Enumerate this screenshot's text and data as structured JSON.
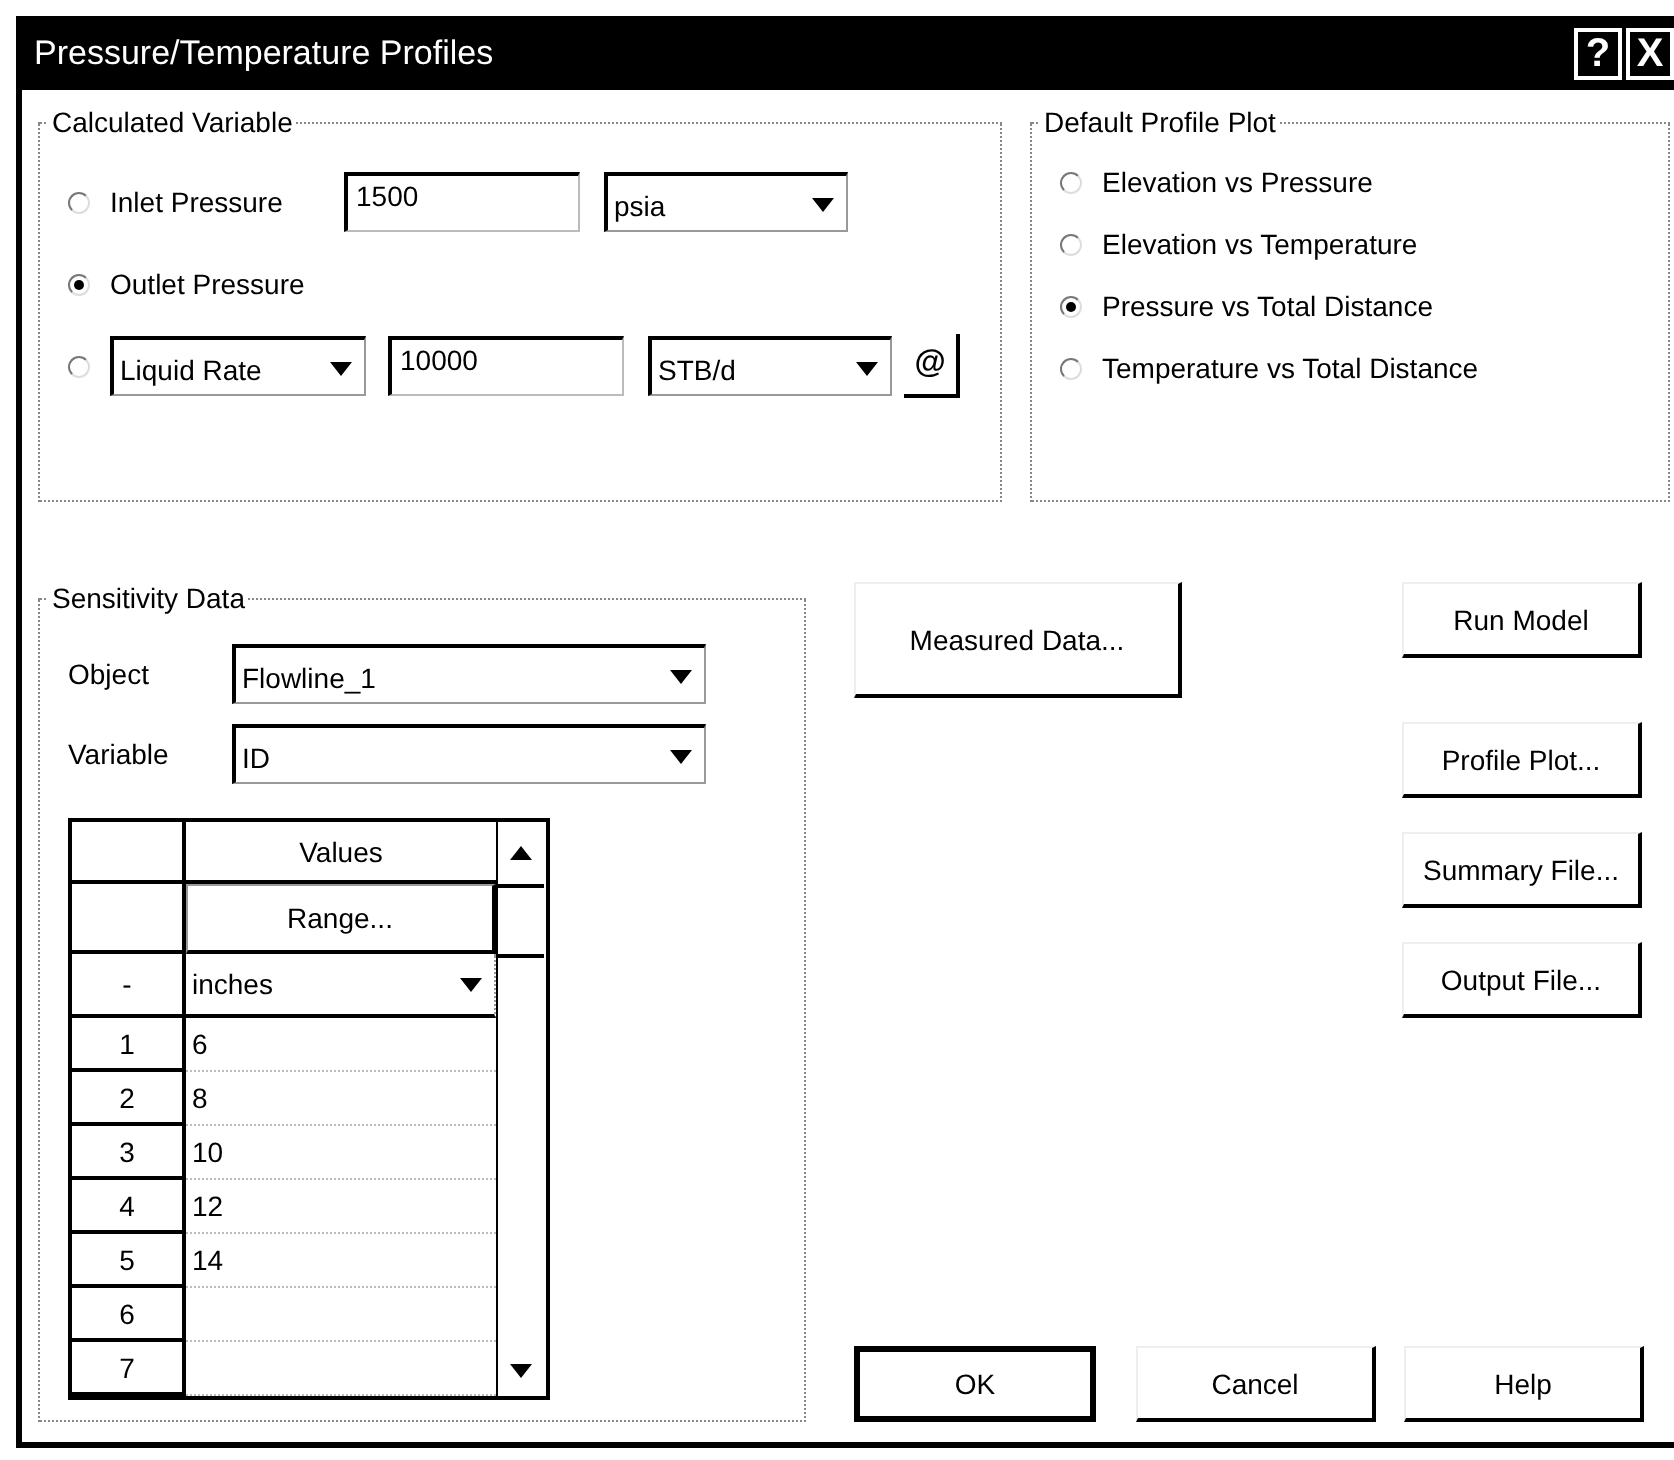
{
  "window": {
    "title": "Pressure/Temperature Profiles",
    "title_buttons": [
      "?",
      "X"
    ]
  },
  "calculated_variable": {
    "title": "Calculated Variable",
    "options": [
      {
        "kind": "fixed",
        "label": "Inlet Pressure",
        "selected": false,
        "value": "1500",
        "unit": "psia"
      },
      {
        "kind": "plain",
        "label": "Outlet Pressure",
        "selected": true
      },
      {
        "kind": "choice",
        "variable": "Liquid Rate",
        "selected": false,
        "value": "10000",
        "unit": "STB/d",
        "button": "@"
      }
    ]
  },
  "default_profile_plot": {
    "title": "Default Profile Plot",
    "options": [
      {
        "label": "Elevation vs Pressure",
        "selected": false
      },
      {
        "label": "Elevation vs Temperature",
        "selected": false
      },
      {
        "label": "Pressure vs Total Distance",
        "selected": true
      },
      {
        "label": "Temperature vs Total Distance",
        "selected": false
      }
    ]
  },
  "sensitivity_data": {
    "title": "Sensitivity Data",
    "object_label": "Object",
    "object": "Flowline_1",
    "variable_label": "Variable",
    "variable": "ID",
    "grid": {
      "column": "Values",
      "range_button": "Range...",
      "unit_row_label": "-",
      "unit": "inches",
      "rows": [
        {
          "index": "1",
          "value": "6"
        },
        {
          "index": "2",
          "value": "8"
        },
        {
          "index": "3",
          "value": "10"
        },
        {
          "index": "4",
          "value": "12"
        },
        {
          "index": "5",
          "value": "14"
        },
        {
          "index": "6"
        },
        {
          "index": "7"
        }
      ]
    }
  },
  "measured_data_button": "Measured Data...",
  "side_buttons": [
    "Run Model",
    "Profile Plot...",
    "Summary File...",
    "Output File..."
  ],
  "footer_buttons": [
    {
      "label": "OK",
      "default": true
    },
    {
      "label": "Cancel",
      "default": false
    },
    {
      "label": "Help",
      "default": false
    }
  ]
}
